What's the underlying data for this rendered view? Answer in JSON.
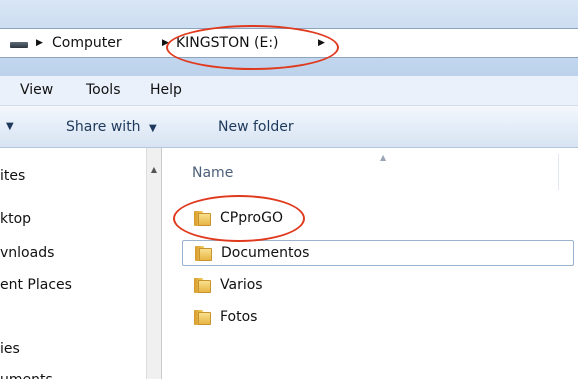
{
  "breadcrumb": {
    "items": [
      {
        "label": "Computer"
      },
      {
        "label": "KINGSTON (E:)"
      }
    ]
  },
  "menu": {
    "items": [
      {
        "label": "View"
      },
      {
        "label": "Tools"
      },
      {
        "label": "Help"
      }
    ]
  },
  "toolbar": {
    "share_label": "Share with",
    "new_folder_label": "New folder"
  },
  "nav_pane": {
    "items": [
      {
        "label": "ites"
      },
      {
        "label": "ktop"
      },
      {
        "label": "vnloads"
      },
      {
        "label": "ent Places"
      },
      {
        "label": "ies"
      },
      {
        "label": "uments"
      }
    ]
  },
  "file_list": {
    "column_name": "Name",
    "files": [
      {
        "name": "CPproGO",
        "icon": "folder-icon"
      },
      {
        "name": "Documentos",
        "icon": "folder-icon"
      },
      {
        "name": "Varios",
        "icon": "folder-icon"
      },
      {
        "name": "Fotos",
        "icon": "folder-icon"
      }
    ]
  },
  "colors": {
    "annotation": "#e03a1e",
    "accent": "#1e395b"
  }
}
